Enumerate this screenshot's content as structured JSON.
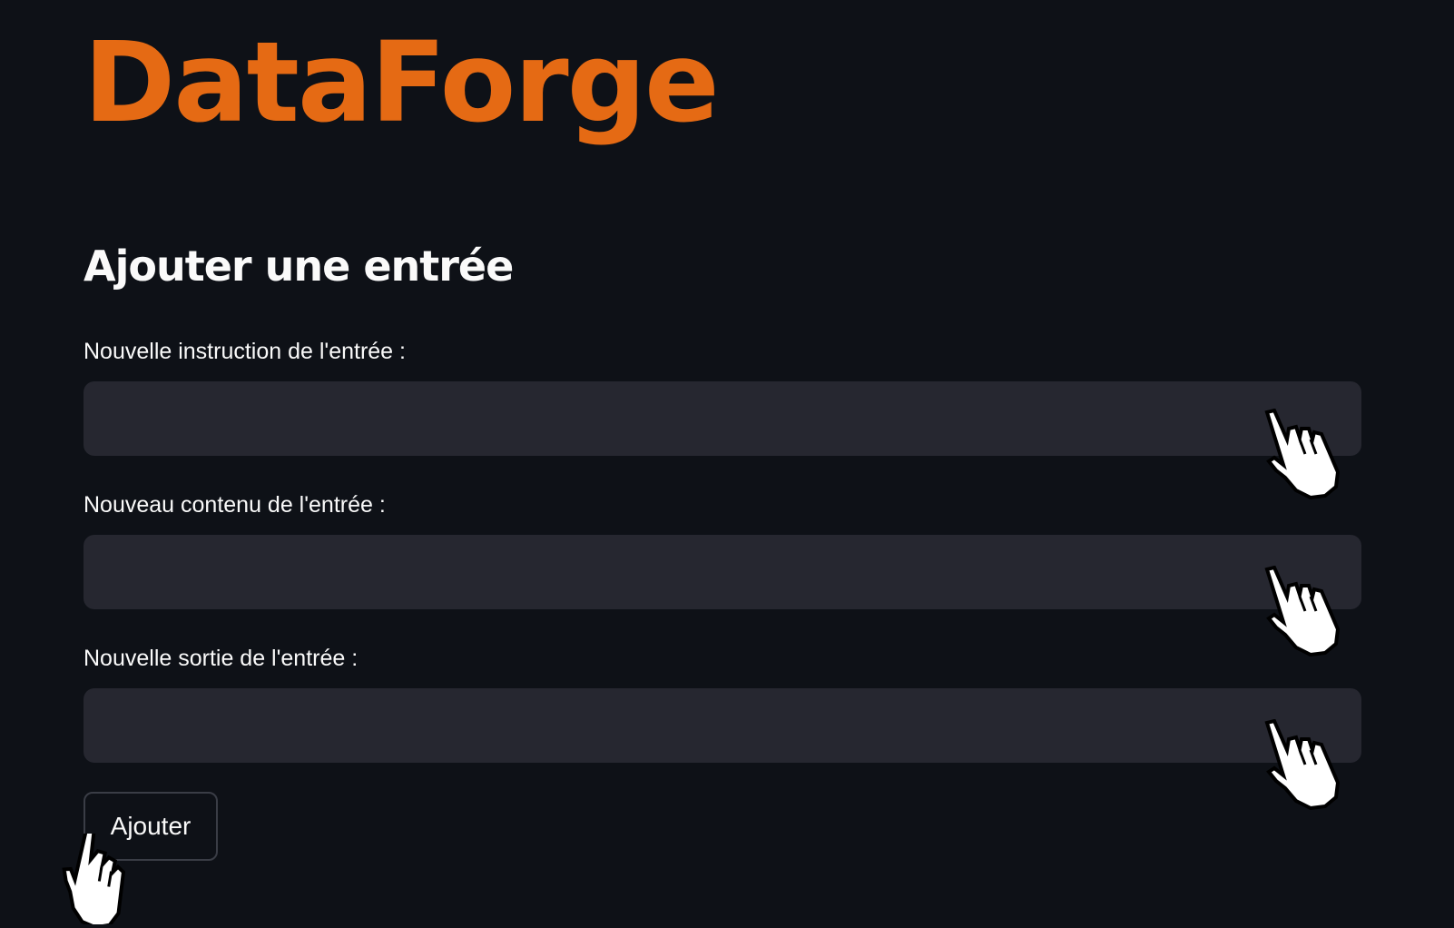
{
  "app": {
    "logo_text": "DataForge",
    "accent_color": "#e56a14"
  },
  "form": {
    "title": "Ajouter une entrée",
    "fields": [
      {
        "label": "Nouvelle instruction de l'entrée :",
        "value": "",
        "placeholder": ""
      },
      {
        "label": "Nouveau contenu de l'entrée :",
        "value": "",
        "placeholder": ""
      },
      {
        "label": "Nouvelle sortie de l'entrée :",
        "value": "",
        "placeholder": ""
      }
    ],
    "submit_label": "Ajouter"
  },
  "icons": {
    "cursor": "hand-pointer-icon"
  }
}
